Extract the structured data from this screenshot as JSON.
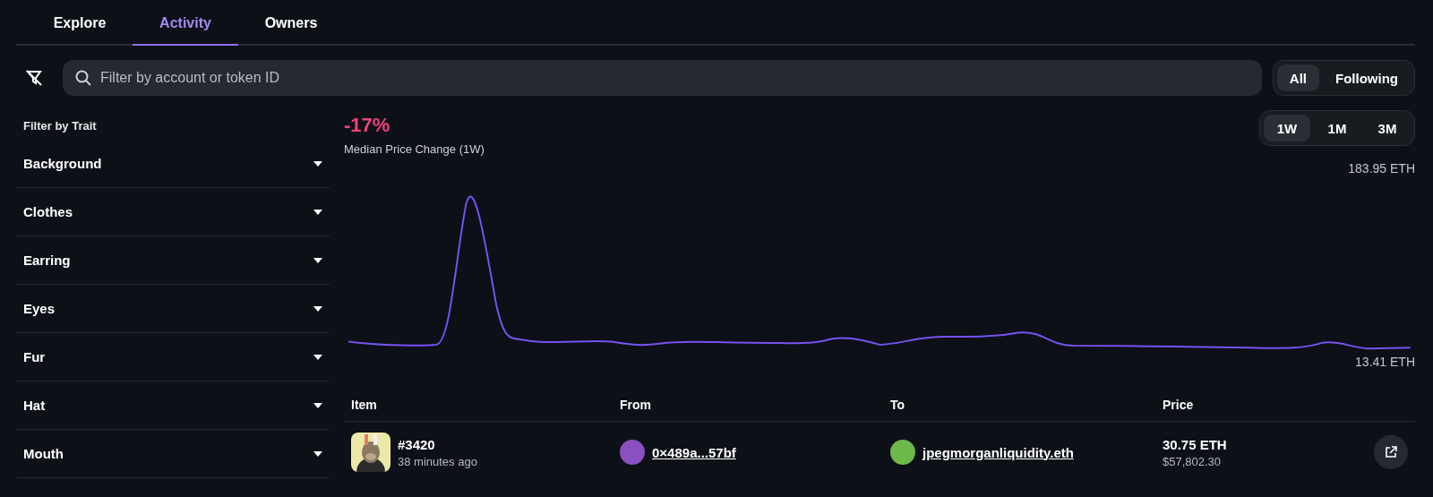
{
  "tabs": [
    {
      "label": "Explore",
      "selected": false
    },
    {
      "label": "Activity",
      "selected": true
    },
    {
      "label": "Owners",
      "selected": false
    }
  ],
  "search": {
    "placeholder": "Filter by account or token ID"
  },
  "feed_toggle": [
    {
      "label": "All",
      "selected": true
    },
    {
      "label": "Following",
      "selected": false
    }
  ],
  "sidebar": {
    "title": "Filter by Trait",
    "items": [
      {
        "label": "Background"
      },
      {
        "label": "Clothes"
      },
      {
        "label": "Earring"
      },
      {
        "label": "Eyes"
      },
      {
        "label": "Fur"
      },
      {
        "label": "Hat"
      },
      {
        "label": "Mouth"
      }
    ]
  },
  "stat": {
    "value": "-17%",
    "label": "Median Price Change (1W)"
  },
  "ranges": [
    {
      "label": "1W",
      "selected": true
    },
    {
      "label": "1M",
      "selected": false
    },
    {
      "label": "3M",
      "selected": false
    }
  ],
  "chart": {
    "max_label": "183.95 ETH",
    "min_label": "13.41 ETH"
  },
  "table": {
    "columns": [
      "Item",
      "From",
      "To",
      "Price"
    ],
    "rows": [
      {
        "item": "#3420",
        "time": "38 minutes ago",
        "from": "0×489a...57bf",
        "to": "jpegmorganliquidity.eth",
        "price": "30.75 ETH",
        "usd": "$57,802.30"
      }
    ]
  }
}
